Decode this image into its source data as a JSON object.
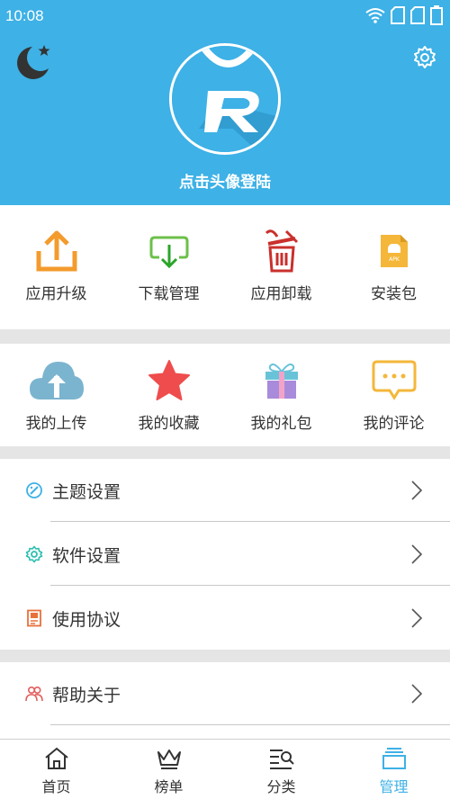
{
  "status_bar": {
    "time": "10:08"
  },
  "header": {
    "login_text": "点击头像登陆"
  },
  "grid_top": [
    {
      "label": "应用升级",
      "icon": "upload-icon"
    },
    {
      "label": "下载管理",
      "icon": "download-icon"
    },
    {
      "label": "应用卸载",
      "icon": "trash-icon"
    },
    {
      "label": "安装包",
      "icon": "apk-icon"
    }
  ],
  "grid_bottom": [
    {
      "label": "我的上传",
      "icon": "cloud-upload-icon"
    },
    {
      "label": "我的收藏",
      "icon": "star-icon"
    },
    {
      "label": "我的礼包",
      "icon": "gift-icon"
    },
    {
      "label": "我的评论",
      "icon": "comment-icon"
    }
  ],
  "settings": [
    {
      "label": "主题设置",
      "icon": "palette-icon"
    },
    {
      "label": "软件设置",
      "icon": "gear-icon"
    },
    {
      "label": "使用协议",
      "icon": "document-icon"
    },
    {
      "label": "帮助关于",
      "icon": "people-icon"
    }
  ],
  "tabs": [
    {
      "label": "首页",
      "icon": "home-icon"
    },
    {
      "label": "榜单",
      "icon": "crown-icon"
    },
    {
      "label": "分类",
      "icon": "category-search-icon"
    },
    {
      "label": "管理",
      "icon": "manage-icon",
      "active": true
    }
  ],
  "colors": {
    "accent": "#3eb1e6",
    "divider": "#e5e5e5"
  }
}
